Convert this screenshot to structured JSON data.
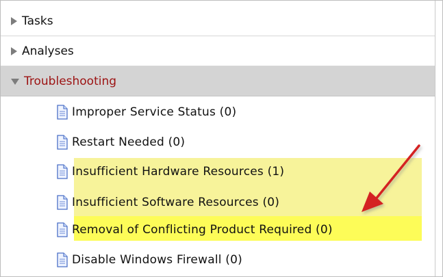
{
  "sections": [
    {
      "label": "Tasks",
      "expanded": false
    },
    {
      "label": "Analyses",
      "expanded": false
    },
    {
      "label": "Troubleshooting",
      "expanded": true
    }
  ],
  "troubleshooting_items": [
    {
      "label": "Improper Service Status (0)",
      "icon": "document-icon",
      "highlighted": false
    },
    {
      "label": "Restart Needed (0)",
      "icon": "document-icon",
      "highlighted": false
    },
    {
      "label": "Insufficient Hardware Resources (1)",
      "icon": "document-icon",
      "highlighted": true
    },
    {
      "label": "Insufficient Software Resources (0)",
      "icon": "document-icon",
      "highlighted": true
    },
    {
      "label": "Removal of Conflicting Product Required (0)",
      "icon": "document-icon",
      "highlighted": true
    },
    {
      "label": "Disable Windows Firewall (0)",
      "icon": "document-icon",
      "highlighted": false
    }
  ],
  "colors": {
    "selected_section_bg": "#d4d4d4",
    "selected_section_text": "#9c1212",
    "highlight_soft": "#f7f39a",
    "highlight_strong": "#fdfc58",
    "annotation_arrow": "#d42020"
  }
}
